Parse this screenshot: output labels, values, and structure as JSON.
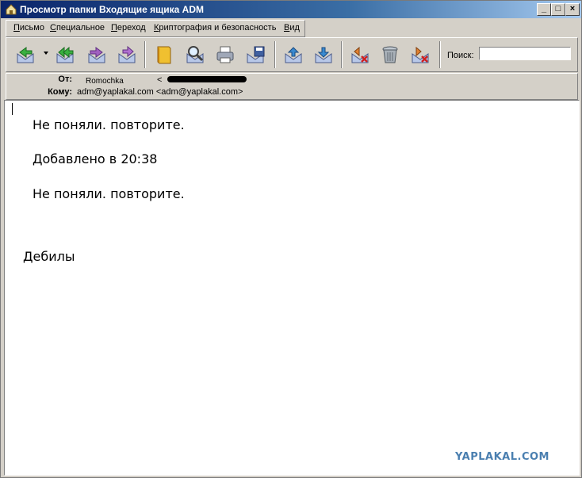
{
  "window": {
    "title": "Просмотр папки Входящие ящика ADM",
    "controls": [
      "_",
      "□",
      "×"
    ]
  },
  "menu": [
    "Письмо",
    "Специальное",
    "Переход",
    "Криптография и безопасность",
    "Вид"
  ],
  "toolbar": {
    "buttons": [
      "reply-icon",
      "reply-all-icon",
      "forward-icon",
      "redirect-icon",
      "address-book-icon",
      "find-icon",
      "print-icon",
      "save-icon",
      "previous-message-icon",
      "next-message-icon",
      "delete-message-icon",
      "trash-icon",
      "delete-forward-icon"
    ],
    "search_label": "Поиск:",
    "search_value": ""
  },
  "header": {
    "from_label": "От:",
    "from_name": "Romochka",
    "from_address_open": "<",
    "from_address_close": ">",
    "to_label": "Кому:",
    "to_value": "adm@yaplakal.com <adm@yaplakal.com>"
  },
  "message": {
    "lines": [
      "Не поняли. повторите.",
      "Добавлено в 20:38",
      "Не поняли. повторите.",
      "Дебилы"
    ]
  },
  "watermark": "YAPLAKAL.COM",
  "colors": {
    "title_bar": "#0a246a",
    "chrome": "#d4d0c8",
    "watermark": "#4a7fb0"
  }
}
